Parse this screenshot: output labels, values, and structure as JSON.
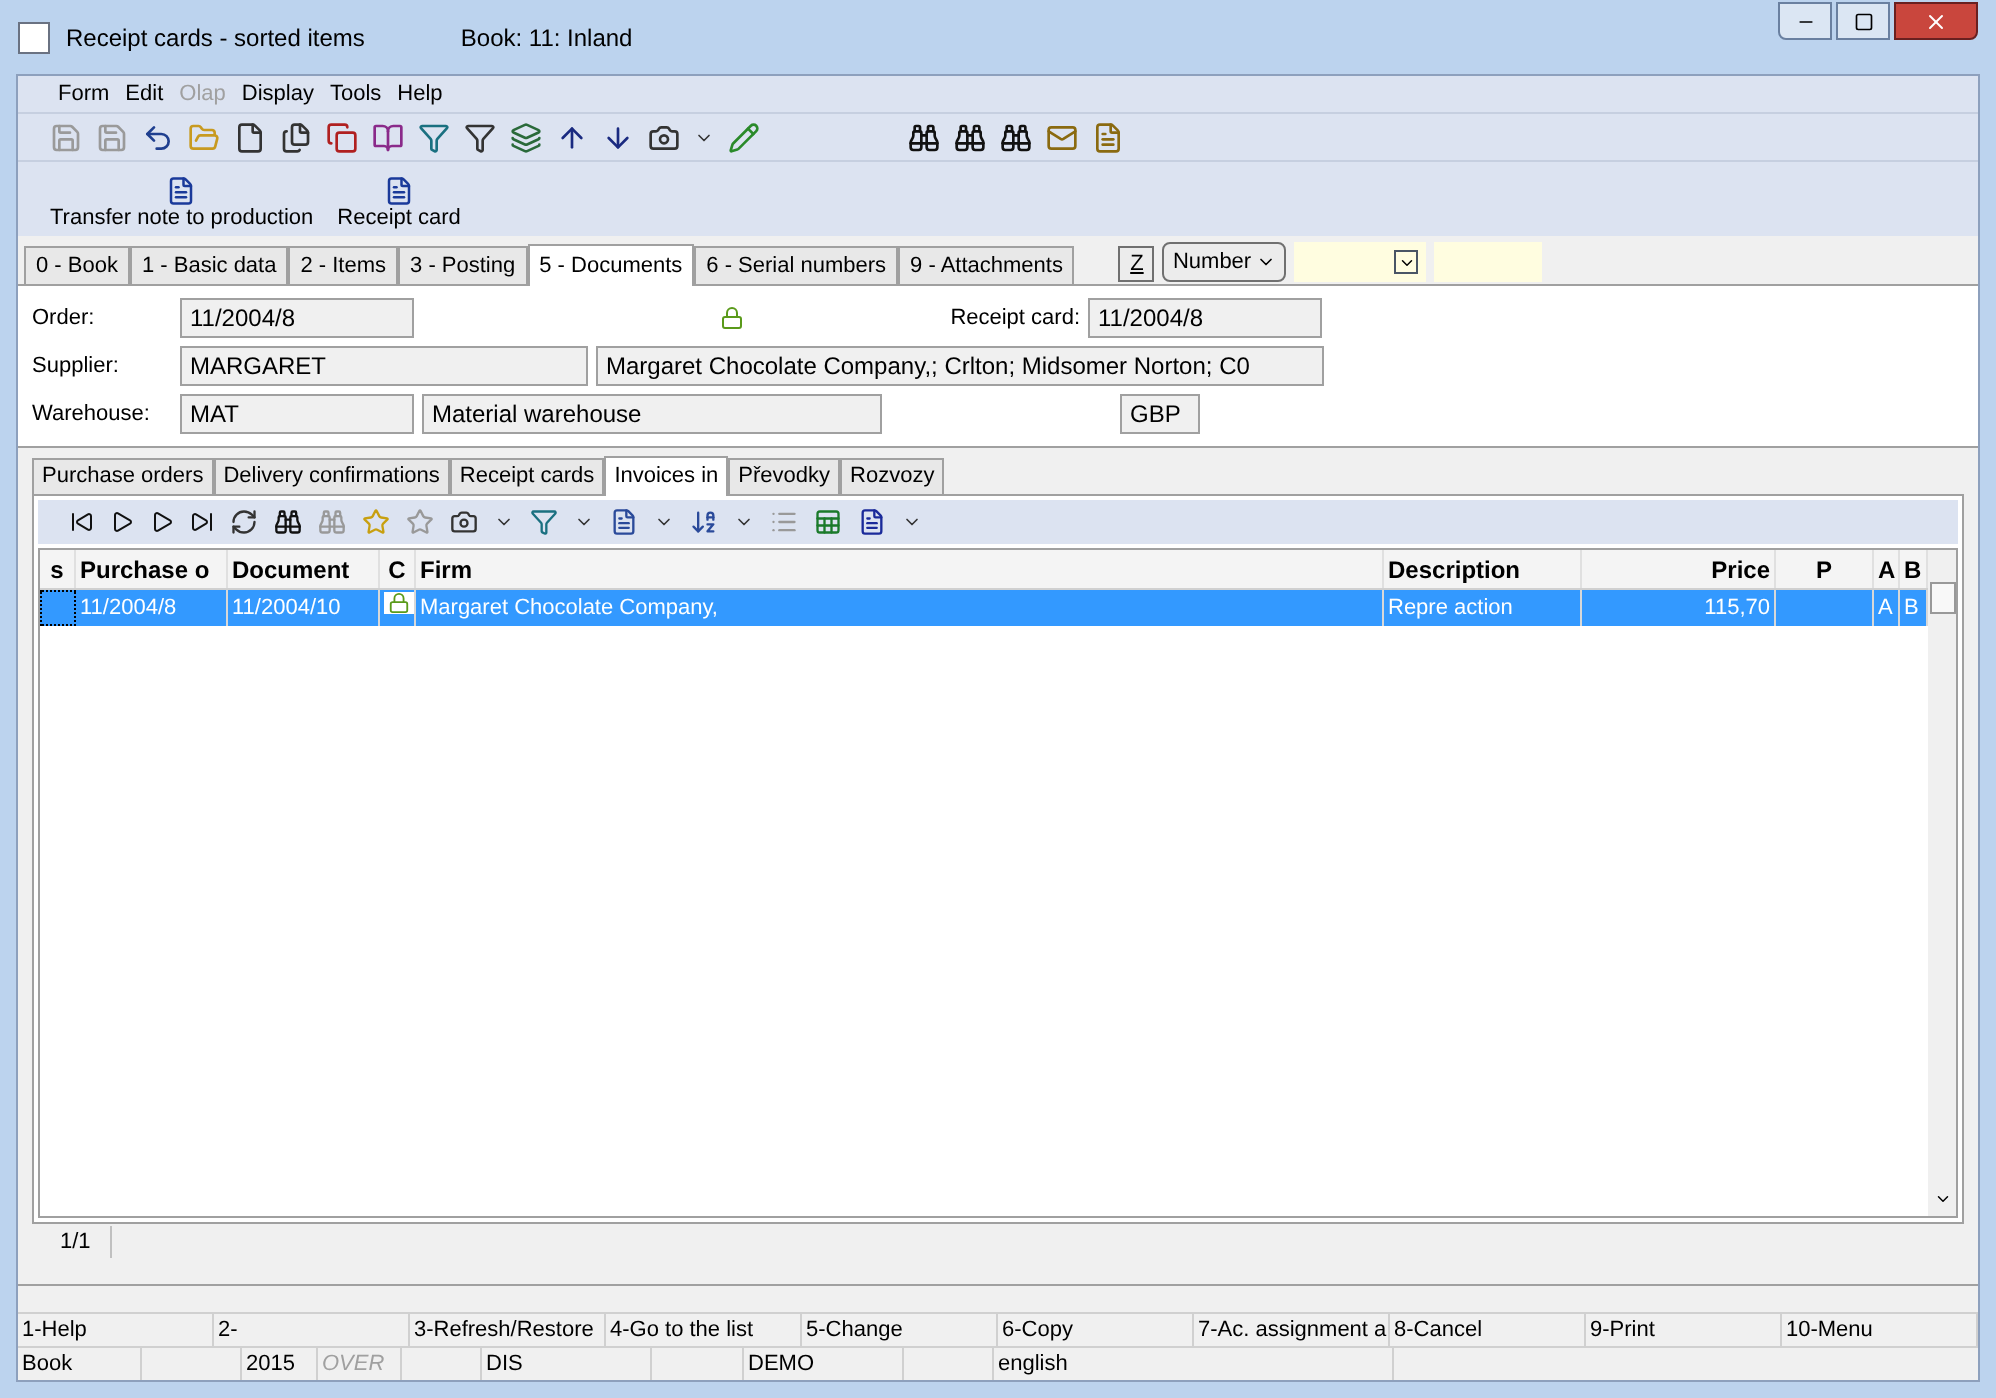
{
  "window": {
    "title": "Receipt cards - sorted items",
    "book": "Book: 11: Inland"
  },
  "menu": [
    {
      "label": "Form",
      "disabled": false
    },
    {
      "label": "Edit",
      "disabled": false
    },
    {
      "label": "Olap",
      "disabled": true
    },
    {
      "label": "Display",
      "disabled": false
    },
    {
      "label": "Tools",
      "disabled": false
    },
    {
      "label": "Help",
      "disabled": false
    }
  ],
  "big_buttons": [
    "Transfer note to production",
    "Receipt card"
  ],
  "tabs": [
    {
      "label": "0 - Book",
      "selected": false
    },
    {
      "label": "1 - Basic data",
      "selected": false
    },
    {
      "label": "2 - Items",
      "selected": false
    },
    {
      "label": "3 - Posting",
      "selected": false
    },
    {
      "label": "5 - Documents",
      "selected": true
    },
    {
      "label": "6 - Serial numbers",
      "selected": false
    },
    {
      "label": "9 - Attachments",
      "selected": false
    }
  ],
  "filter": {
    "z_button": "Z",
    "sort": "Number"
  },
  "form": {
    "order_label": "Order:",
    "order": "11/2004/8",
    "receipt_card_label": "Receipt card:",
    "receipt_card": "11/2004/8",
    "supplier_label": "Supplier:",
    "supplier_code": "MARGARET",
    "supplier_name": "Margaret Chocolate Company,; Crlton; Midsomer Norton; C0",
    "warehouse_label": "Warehouse:",
    "warehouse_code": "MAT",
    "warehouse_name": "Material warehouse",
    "currency": "GBP"
  },
  "subtabs": [
    {
      "label": "Purchase orders",
      "selected": false
    },
    {
      "label": "Delivery confirmations",
      "selected": false
    },
    {
      "label": "Receipt cards",
      "selected": false
    },
    {
      "label": "Invoices in",
      "selected": true
    },
    {
      "label": "Převodky",
      "selected": false
    },
    {
      "label": "Rozvozy",
      "selected": false
    }
  ],
  "grid": {
    "columns": [
      "s",
      "Purchase o",
      "Document",
      "C",
      "Firm",
      "Description",
      "Price",
      "P",
      "A",
      "B"
    ],
    "rows": [
      {
        "selected": true,
        "purchase_order": "11/2004/8",
        "document": "11/2004/10",
        "locked": true,
        "firm": "Margaret Chocolate Company,",
        "description": "Repre action",
        "price": "115,70",
        "a": "A",
        "b": "B"
      }
    ]
  },
  "pager": "1/1",
  "function_keys": [
    "1-Help",
    "2-",
    "3-Refresh/Restore",
    "4-Go to the list",
    "5-Change",
    "6-Copy",
    "7-Ac. assignment a",
    "8-Cancel",
    "9-Print",
    "10-Menu"
  ],
  "status": [
    {
      "text": "Book",
      "disabled": false
    },
    {
      "text": "2015",
      "disabled": false
    },
    {
      "text": "OVER",
      "disabled": true
    },
    {
      "text": "DIS",
      "disabled": false
    },
    {
      "text": "DEMO",
      "disabled": false
    },
    {
      "text": "english",
      "disabled": false
    }
  ]
}
